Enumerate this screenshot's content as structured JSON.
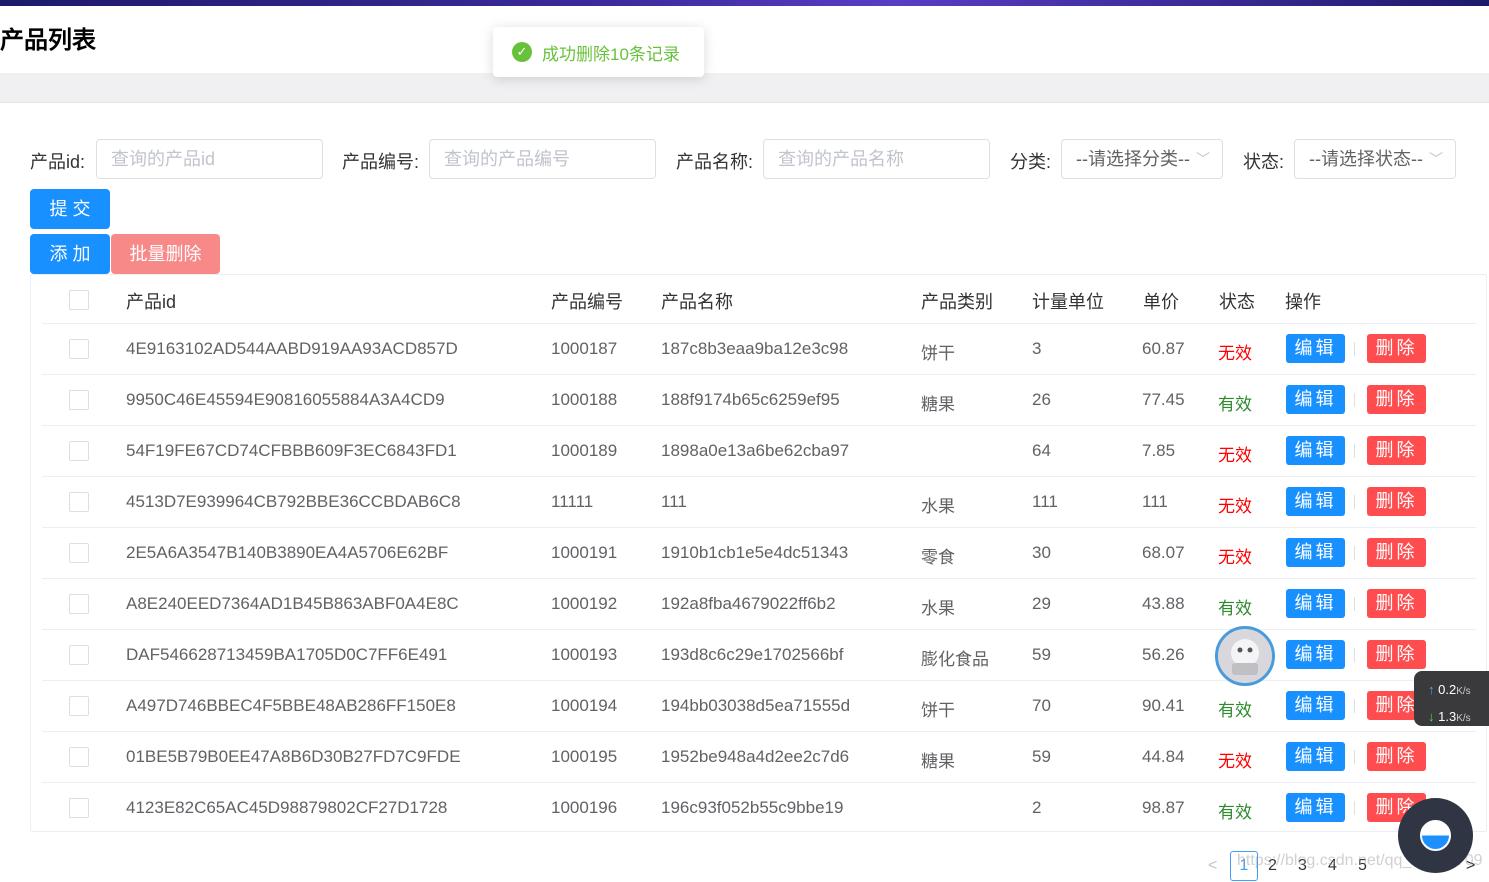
{
  "page": {
    "title": "产品列表"
  },
  "toast": {
    "message": "成功删除10条记录"
  },
  "search": {
    "id_label": "产品id:",
    "id_placeholder": "查询的产品id",
    "code_label": "产品编号:",
    "code_placeholder": "查询的产品编号",
    "name_label": "产品名称:",
    "name_placeholder": "查询的产品名称",
    "category_label": "分类:",
    "category_value": "--请选择分类--",
    "status_label": "状态:",
    "status_value": "--请选择状态--",
    "submit_label": "提 交"
  },
  "actions": {
    "add_label": "添 加",
    "batch_delete_label": "批量删除"
  },
  "table": {
    "headers": {
      "id": "产品id",
      "code": "产品编号",
      "name": "产品名称",
      "category": "产品类别",
      "unit": "计量单位",
      "price": "单价",
      "status": "状态",
      "ops": "操作"
    },
    "edit_label": "编辑",
    "delete_label": "删除",
    "rows": [
      {
        "id": "4E9163102AD544AABD919AA93ACD857D",
        "code": "1000187",
        "name": "187c8b3eaa9ba12e3c98",
        "category": "饼干",
        "unit": "3",
        "price": "60.87",
        "status": "无效"
      },
      {
        "id": "9950C46E45594E90816055884A3A4CD9",
        "code": "1000188",
        "name": "188f9174b65c6259ef95",
        "category": "糖果",
        "unit": "26",
        "price": "77.45",
        "status": "有效"
      },
      {
        "id": "54F19FE67CD74CFBBB609F3EC6843FD1",
        "code": "1000189",
        "name": "1898a0e13a6be62cba97",
        "category": "",
        "unit": "64",
        "price": "7.85",
        "status": "无效"
      },
      {
        "id": "4513D7E939964CB792BBE36CCBDAB6C8",
        "code": "11111",
        "name": "111",
        "category": "水果",
        "unit": "111",
        "price": "111",
        "status": "无效"
      },
      {
        "id": "2E5A6A3547B140B3890EA4A5706E62BF",
        "code": "1000191",
        "name": "1910b1cb1e5e4dc51343",
        "category": "零食",
        "unit": "30",
        "price": "68.07",
        "status": "无效"
      },
      {
        "id": "A8E240EED7364AD1B45B863ABF0A4E8C",
        "code": "1000192",
        "name": "192a8fba4679022ff6b2",
        "category": "水果",
        "unit": "29",
        "price": "43.88",
        "status": "有效"
      },
      {
        "id": "DAF546628713459BA1705D0C7FF6E491",
        "code": "1000193",
        "name": "193d8c6c29e1702566bf",
        "category": "膨化食品",
        "unit": "59",
        "price": "56.26",
        "status": ""
      },
      {
        "id": "A497D746BBEC4F5BBE48AB286FF150E8",
        "code": "1000194",
        "name": "194bb03038d5ea71555d",
        "category": "饼干",
        "unit": "70",
        "price": "90.41",
        "status": "有效"
      },
      {
        "id": "01BE5B79B0EE47A8B6D30B27FD7C9FDE",
        "code": "1000195",
        "name": "1952be948a4d2ee2c7d6",
        "category": "糖果",
        "unit": "59",
        "price": "44.84",
        "status": "无效"
      },
      {
        "id": "4123E82C65AC45D98879802CF27D1728",
        "code": "1000196",
        "name": "196c93f052b55c9bbe19",
        "category": "",
        "unit": "2",
        "price": "98.87",
        "status": "有效"
      }
    ]
  },
  "pagination": {
    "prev": "<",
    "pages": [
      "1",
      "2",
      "3",
      "4",
      "5"
    ],
    "current": "1",
    "next": ">"
  },
  "overlay": {
    "upload_speed": "0.2",
    "download_speed": "1.3",
    "speed_unit": "K/s",
    "watermark": "https://blog.csdn.net/qq_35986709"
  },
  "colors": {
    "primary": "#1890ff",
    "danger": "#ff4d4f",
    "success": "#67c23a",
    "invalid": "#ff0000",
    "valid": "#2e8b2e"
  }
}
